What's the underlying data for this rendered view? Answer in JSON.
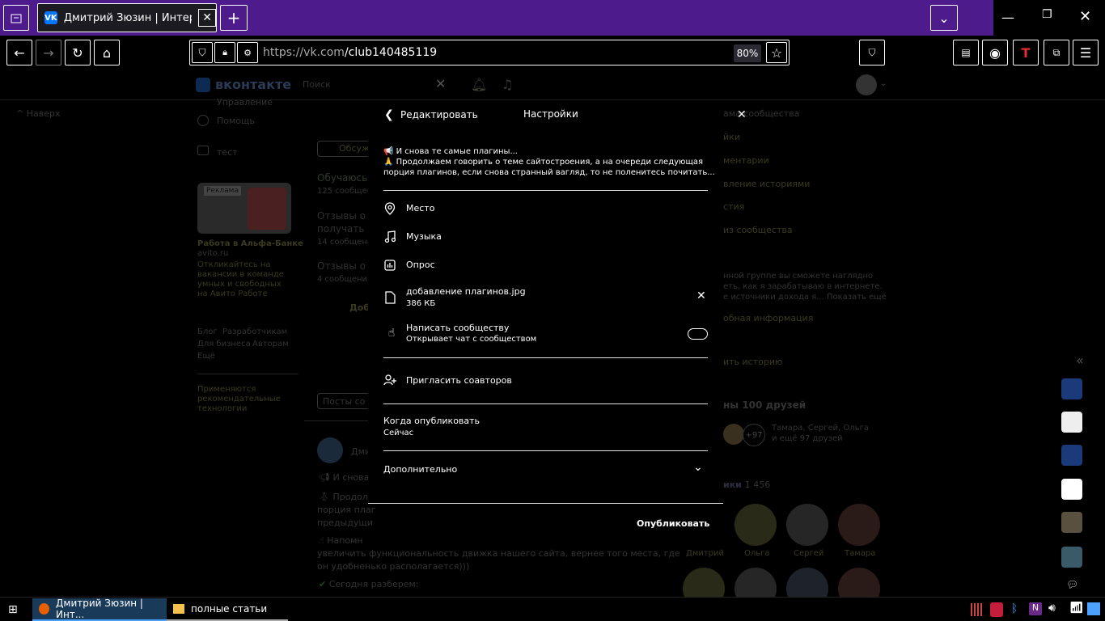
{
  "browser": {
    "tab_title": "Дмитрий Зюзин | Интернет -",
    "url_host": "https://vk.com",
    "url_path": "/club140485119",
    "zoom": "80%"
  },
  "vk": {
    "logo": "вконтакте",
    "search_placeholder": "Поиск",
    "up_label": "Наверх",
    "left_menu": [
      "Управление",
      "Помощь",
      "тест"
    ],
    "ad_title": "Работа в Альфа-Банке",
    "ad_domain": "avito.ru",
    "ad_text": "Откликайтесь на вакансии в команде умных и свободных на Авито Работе",
    "ad_label": "Реклама",
    "footer_links": [
      "Блог",
      "Разработчикам",
      "Для бизнеса",
      "Авторам",
      "Ещё"
    ],
    "footer_note": "Применяются рекомендательные технологии",
    "center": {
      "discussions_btn": "Обсуж",
      "topic1": "Обучаюсь",
      "topic1_count": "125 сообщен",
      "topic2a": "Отзывы о",
      "topic2b": "получать д",
      "topic2_count": "14 сообщени",
      "topic3": "Отзывы о",
      "topic3_count": "4 сообщения",
      "add": "Доб",
      "posts_btn": "Посты со",
      "author": "Дми",
      "post_l1": "И снова",
      "post_l2": "Продолж",
      "post_l3": "порция плаг",
      "post_l4": "предыдущи",
      "post_l5": "Напомн",
      "post_l6": "увеличить функциональность движка нашего сайта, вернее того места, где",
      "post_l7": "он удобненько располагается)))",
      "post_l8": "Сегодня разберем:"
    },
    "right": {
      "items": [
        "ама сообщества",
        "йки",
        "ментарии",
        "вление историями",
        "стия",
        "из сообщества"
      ],
      "about1": "нной группе вы сможете наглядно",
      "about2": "еть, как я зарабатываю в интернете.",
      "about3": "е источники дохода я... Показать ещё",
      "more_info": "обная информация",
      "add_story": "ить историю",
      "friends_title": "ны 100 друзей",
      "friends_count_badge": "+97",
      "friends_names": "Тамара, Сергей, Ольга",
      "friends_more": "и ещё 97 друзей",
      "members_label": "ики",
      "members_count": "1 456",
      "member_names": [
        "Дмитрий",
        "Ольга",
        "Сергей",
        "Тамара"
      ]
    }
  },
  "modal": {
    "back_label": "Редактировать",
    "title": "Настройки",
    "post_line1": "📢 И снова те самые плагины...",
    "post_line2": "🙏 Продолжаем говорить о теме сайтостроения, а на очереди следующая",
    "post_line3": "порция плагинов, если снова странный вагляд, то не поленитесь почитать...",
    "place": "Место",
    "music": "Музыка",
    "poll": "Опрос",
    "file_name": "добавление плагинов.jpg",
    "file_size": "386 КБ",
    "write_community": "Написать сообществу",
    "write_community_sub": "Открывает чат с сообществом",
    "invite": "Пригласить соавторов",
    "when_label": "Когда опубликовать",
    "when_value": "Сейчас",
    "extra": "Дополнительно",
    "publish": "Опубликовать"
  },
  "taskbar": {
    "task1": "Дмитрий Зюзин | Инт...",
    "task2": "полные статьи"
  },
  "colors": {
    "tabbar": "#4d1b8c",
    "vk_blue": "#0077ff"
  }
}
